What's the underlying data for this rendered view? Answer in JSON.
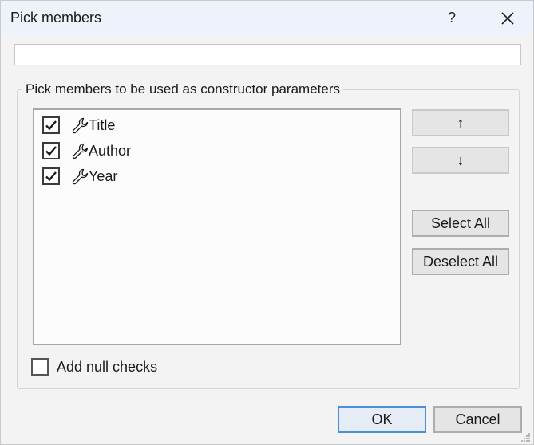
{
  "window": {
    "title": "Pick members",
    "help_glyph": "?",
    "close_icon": "close-icon"
  },
  "filter": {
    "value": "",
    "placeholder": ""
  },
  "group": {
    "legend": "Pick members to be used as constructor parameters"
  },
  "members": [
    {
      "label": "Title",
      "checked": true,
      "icon": "wrench-icon"
    },
    {
      "label": "Author",
      "checked": true,
      "icon": "wrench-icon"
    },
    {
      "label": "Year",
      "checked": true,
      "icon": "wrench-icon"
    }
  ],
  "side_buttons": {
    "move_up": "↑",
    "move_down": "↓",
    "select_all": "Select All",
    "deselect_all": "Deselect All"
  },
  "options": {
    "null_checks_label": "Add null checks",
    "null_checks_checked": false
  },
  "footer": {
    "ok_label": "OK",
    "cancel_label": "Cancel"
  },
  "colors": {
    "titlebar": "#eef2fa",
    "dialog_bg": "#f3f3f3",
    "ok_focus_border": "#4a90d9"
  }
}
